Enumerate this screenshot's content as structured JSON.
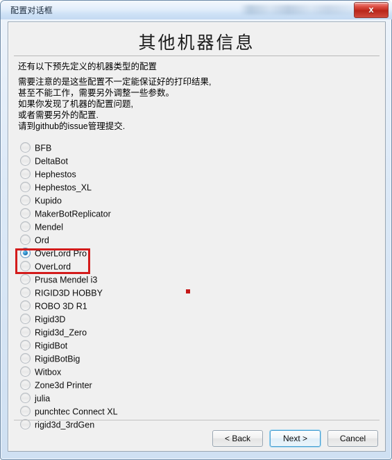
{
  "window": {
    "title": "配置对话框",
    "close_label": "x"
  },
  "page": {
    "heading": "其他机器信息",
    "description": {
      "lead": "还有以下预先定义的机器类型的配置",
      "lines": [
        "需要注意的是这些配置不一定能保证好的打印结果,",
        "甚至不能工作，需要另外调整一些参数。",
        "如果你发现了机器的配置问题,",
        "或者需要另外的配置.",
        "请到github的issue管理提交."
      ]
    }
  },
  "machine_list": {
    "selected": "OverLord Pro",
    "items": [
      {
        "label": "BFB",
        "checked": false
      },
      {
        "label": "DeltaBot",
        "checked": false
      },
      {
        "label": "Hephestos",
        "checked": false
      },
      {
        "label": "Hephestos_XL",
        "checked": false
      },
      {
        "label": "Kupido",
        "checked": false
      },
      {
        "label": "MakerBotReplicator",
        "checked": false
      },
      {
        "label": "Mendel",
        "checked": false
      },
      {
        "label": "Ord",
        "checked": false
      },
      {
        "label": "OverLord Pro",
        "checked": true
      },
      {
        "label": "OverLord",
        "checked": false
      },
      {
        "label": "Prusa Mendel i3",
        "checked": false
      },
      {
        "label": "RIGID3D HOBBY",
        "checked": false
      },
      {
        "label": "ROBO 3D R1",
        "checked": false
      },
      {
        "label": "Rigid3D",
        "checked": false
      },
      {
        "label": "Rigid3d_Zero",
        "checked": false
      },
      {
        "label": "RigidBot",
        "checked": false
      },
      {
        "label": "RigidBotBig",
        "checked": false
      },
      {
        "label": "Witbox",
        "checked": false
      },
      {
        "label": "Zone3d Printer",
        "checked": false
      },
      {
        "label": "julia",
        "checked": false
      },
      {
        "label": "punchtec Connect XL",
        "checked": false
      },
      {
        "label": "rigid3d_3rdGen",
        "checked": false
      }
    ]
  },
  "annotations": {
    "highlight_color": "#d31b1b",
    "highlight_targets": [
      "OverLord Pro",
      "OverLord"
    ],
    "marker_color": "#c51818"
  },
  "footer": {
    "back_label": "< Back",
    "next_label": "Next >",
    "cancel_label": "Cancel",
    "default_button": "Next >"
  }
}
